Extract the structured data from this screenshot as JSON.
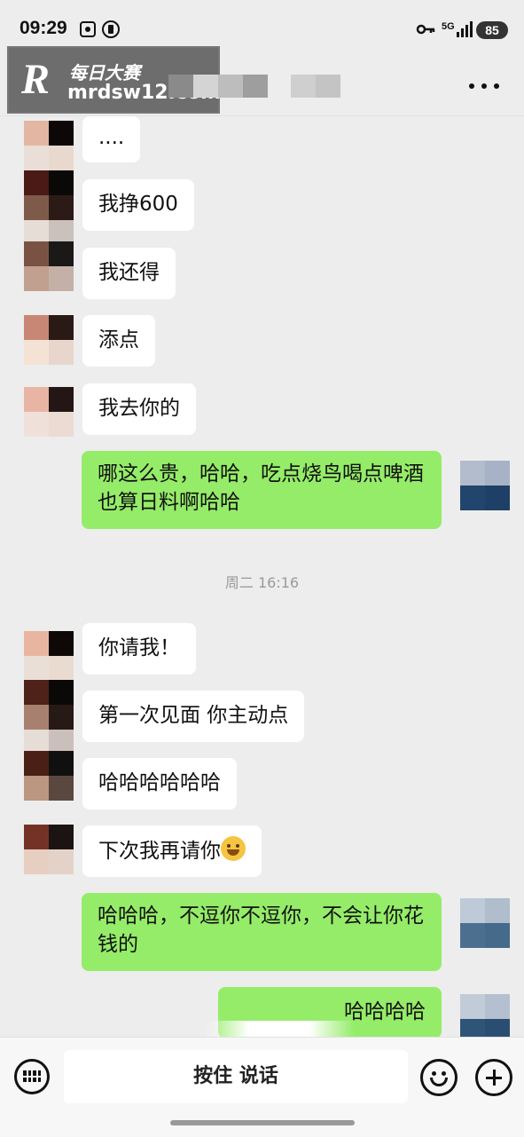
{
  "status_bar": {
    "time": "09:29",
    "battery": "85",
    "network": "5G"
  },
  "watermark": {
    "logo": "R",
    "top": "每日大赛",
    "url": "mrdsw12.com"
  },
  "header": {
    "more_icon": "more-icon"
  },
  "timestamp": "周二 16:16",
  "messages": [
    {
      "side": "left",
      "text": "...."
    },
    {
      "side": "left",
      "text": "我挣600"
    },
    {
      "side": "left",
      "text": "我还得"
    },
    {
      "side": "left",
      "text": "添点"
    },
    {
      "side": "left",
      "text": "我去你的"
    },
    {
      "side": "right",
      "text": "哪这么贵，哈哈，吃点烧鸟喝点啤酒也算日料啊哈哈"
    },
    {
      "side": "left",
      "text": "你请我！"
    },
    {
      "side": "left",
      "text": "第一次见面 你主动点"
    },
    {
      "side": "left",
      "text": "哈哈哈哈哈哈"
    },
    {
      "side": "left",
      "text": "下次我再请你"
    },
    {
      "side": "right",
      "text": "哈哈哈，不逗你不逗你，不会让你花钱的"
    },
    {
      "side": "right",
      "text": "哈哈哈哈"
    }
  ],
  "input_bar": {
    "voice_label": "按住 说话"
  },
  "colors": {
    "bubble_right": "#95ec69",
    "bubble_left": "#ffffff",
    "background": "#ededed"
  }
}
